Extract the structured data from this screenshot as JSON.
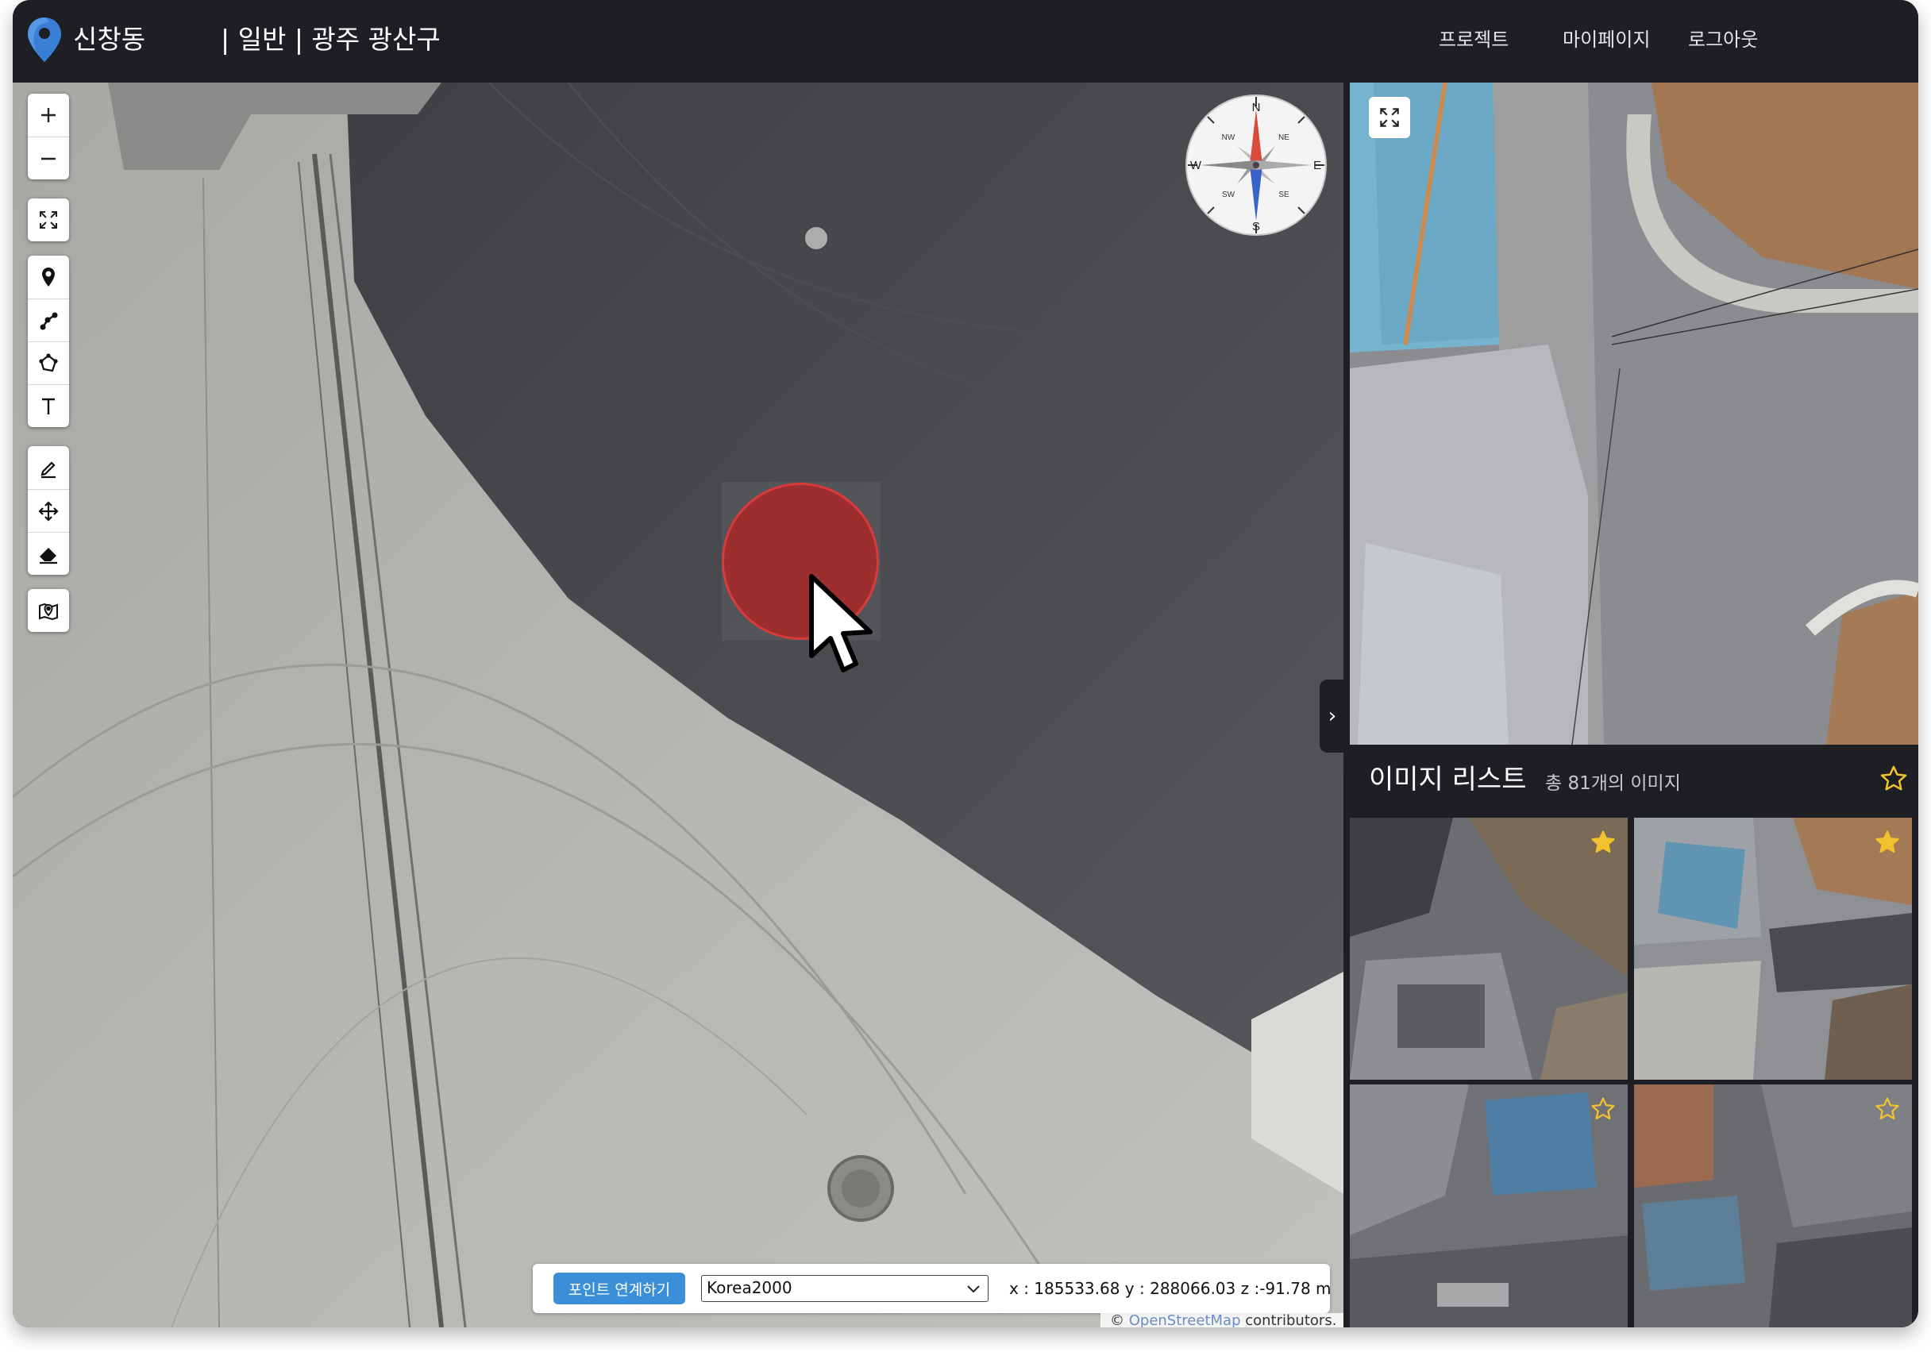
{
  "header": {
    "brand": "신창동",
    "subtitle": "| 일반 | 광주 광산구",
    "nav": [
      {
        "label": "프로젝트"
      },
      {
        "label": "마이페이지"
      },
      {
        "label": "로그아웃"
      }
    ]
  },
  "map": {
    "toolbar": {
      "groups": [
        [
          "zoom-in-icon",
          "zoom-out-icon"
        ],
        [
          "fullscreen-icon"
        ],
        [
          "point-marker-icon",
          "line-icon",
          "polygon-icon",
          "text-icon"
        ],
        [
          "edit-icon",
          "move-icon",
          "eraser-icon"
        ],
        [
          "map-layer-icon"
        ]
      ]
    },
    "compass": {
      "n": "N",
      "s": "S",
      "e": "E",
      "w": "W",
      "ne": "NE",
      "nw": "NW",
      "se": "SE",
      "sw": "SW"
    },
    "coord_bar": {
      "link_button": "포인트 연계하기",
      "crs_selected": "Korea2000",
      "coords": "x : 185533.68 y : 288066.03 z :-91.78 m"
    },
    "attribution": {
      "prefix": "©",
      "link": "OpenStreetMap",
      "suffix": "contributors."
    }
  },
  "panel": {
    "toggle_glyph": "›",
    "list_title": "이미지 리스트",
    "list_count": "총 81개의 이미지",
    "thumbnails": [
      {
        "favorite": true
      },
      {
        "favorite": true
      },
      {
        "favorite": false
      },
      {
        "favorite": false
      }
    ]
  },
  "colors": {
    "header_bg": "#1d1f24",
    "accent_blue": "#3b8fd9",
    "marker_red": "#b22424",
    "star_gold": "#f2c12e"
  }
}
